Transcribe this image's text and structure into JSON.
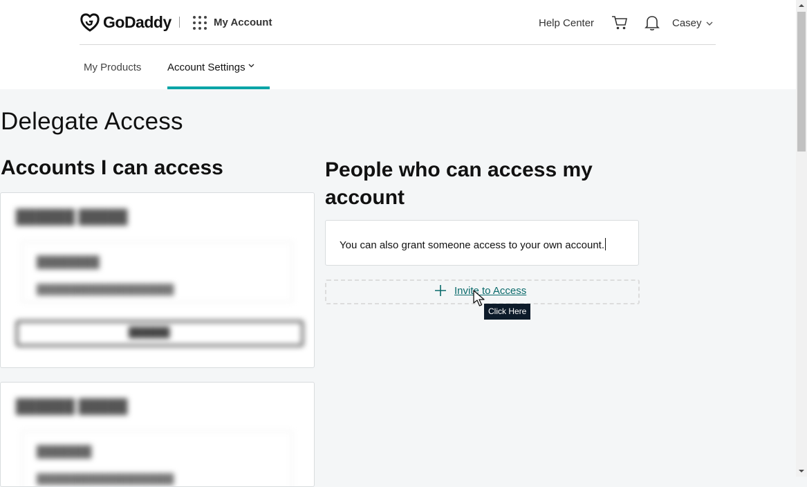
{
  "header": {
    "brand": "GoDaddy",
    "section": "My Account",
    "help": "Help Center",
    "user": "Casey",
    "icons": [
      "godaddy-logo",
      "apps-grid-icon",
      "cart-icon",
      "bell-icon",
      "chevron-down-icon"
    ]
  },
  "tabs": [
    {
      "label": "My Products",
      "active": false
    },
    {
      "label": "Account Settings",
      "active": true
    }
  ],
  "page": {
    "title": "Delegate Access",
    "left_heading": "Accounts I can access",
    "right_heading": "People who can access my account",
    "info_text": "You can also grant someone access to your own account.",
    "invite_label": "Invite to Access",
    "tooltip": "Click Here"
  },
  "colors": {
    "accent": "#00a4a6",
    "link": "#0a6a6b",
    "tooltip_bg": "#0d1b2a",
    "page_bg": "#f4f6f7"
  }
}
